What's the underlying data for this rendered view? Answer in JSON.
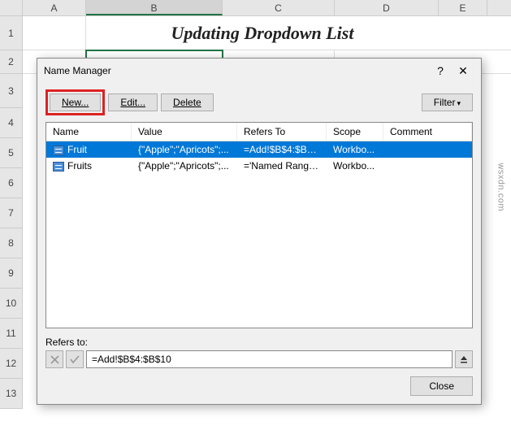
{
  "columns": [
    "A",
    "B",
    "C",
    "D",
    "E"
  ],
  "rows": [
    "1",
    "2",
    "3",
    "4",
    "5",
    "6",
    "7",
    "8",
    "9",
    "10",
    "11",
    "12",
    "13"
  ],
  "title_text": "Updating Dropdown List",
  "dialog": {
    "title": "Name Manager",
    "help": "?",
    "close": "✕",
    "buttons": {
      "new": "New...",
      "edit": "Edit...",
      "delete": "Delete",
      "filter": "Filter",
      "close": "Close"
    },
    "headers": {
      "name": "Name",
      "value": "Value",
      "refers": "Refers To",
      "scope": "Scope",
      "comment": "Comment"
    },
    "items": [
      {
        "name": "Fruit",
        "value": "{\"Apple\";\"Apricots\";...",
        "refers": "=Add!$B$4:$B$10",
        "scope": "Workbo...",
        "comment": ""
      },
      {
        "name": "Fruits",
        "value": "{\"Apple\";\"Apricots\";...",
        "refers": "='Named Range'!$...",
        "scope": "Workbo...",
        "comment": ""
      }
    ],
    "refers_label": "Refers to:",
    "refers_value": "=Add!$B$4:$B$10"
  },
  "watermark": "wsxdn.com"
}
